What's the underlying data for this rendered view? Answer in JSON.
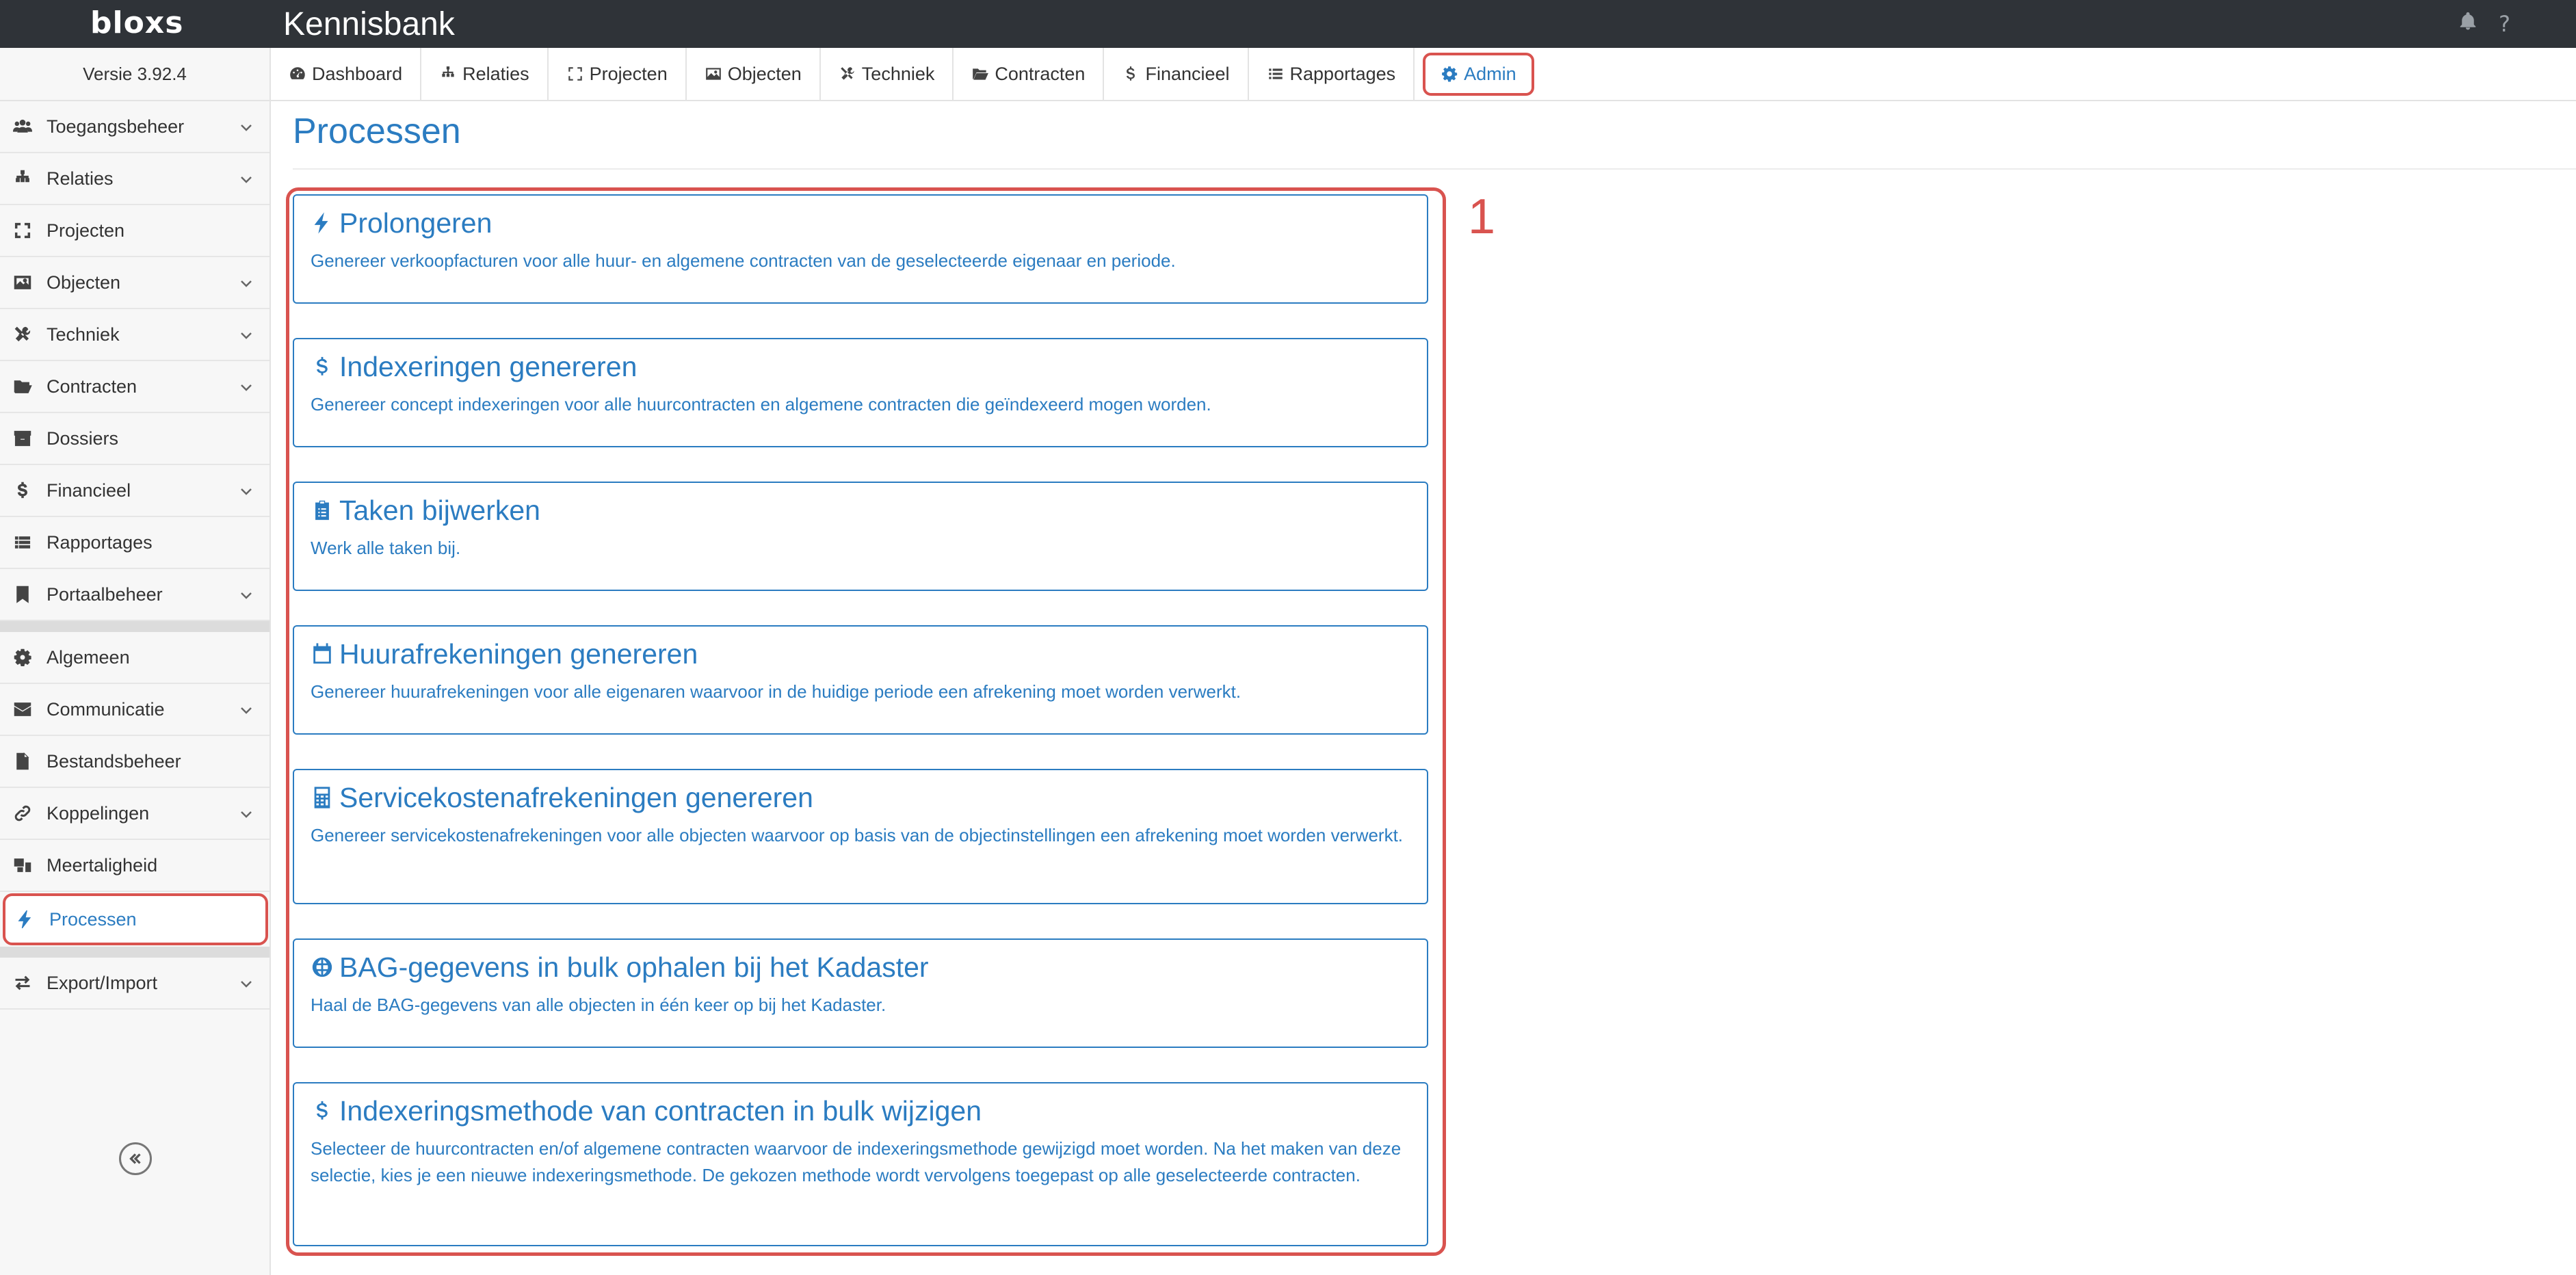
{
  "app": {
    "logo": "bloxs",
    "title": "Kennisbank",
    "version": "Versie 3.92.4"
  },
  "nav": {
    "tabs": [
      {
        "label": "Dashboard",
        "icon": "dashboard-icon"
      },
      {
        "label": "Relaties",
        "icon": "sitemap-icon"
      },
      {
        "label": "Projecten",
        "icon": "expand-icon"
      },
      {
        "label": "Objecten",
        "icon": "image-icon"
      },
      {
        "label": "Techniek",
        "icon": "tools-icon"
      },
      {
        "label": "Contracten",
        "icon": "folder-open-icon"
      },
      {
        "label": "Financieel",
        "icon": "dollar-icon"
      },
      {
        "label": "Rapportages",
        "icon": "list-icon"
      },
      {
        "label": "Admin",
        "icon": "gear-icon"
      }
    ]
  },
  "sidebar": {
    "items": [
      {
        "label": "Toegangsbeheer"
      },
      {
        "label": "Relaties"
      },
      {
        "label": "Projecten"
      },
      {
        "label": "Objecten"
      },
      {
        "label": "Techniek"
      },
      {
        "label": "Contracten"
      },
      {
        "label": "Dossiers"
      },
      {
        "label": "Financieel"
      },
      {
        "label": "Rapportages"
      },
      {
        "label": "Portaalbeheer"
      },
      {
        "label": "Algemeen"
      },
      {
        "label": "Communicatie"
      },
      {
        "label": "Bestandsbeheer"
      },
      {
        "label": "Koppelingen"
      },
      {
        "label": "Meertaligheid"
      },
      {
        "label": "Processen"
      },
      {
        "label": "Export/Import"
      }
    ]
  },
  "main": {
    "title": "Processen",
    "callout": "1",
    "processes": [
      {
        "title": "Prolongeren",
        "icon": "bolt-icon",
        "description": "Genereer verkoopfacturen voor alle huur- en algemene contracten van de geselecteerde eigenaar en periode."
      },
      {
        "title": "Indexeringen genereren",
        "icon": "dollar-icon",
        "description": "Genereer concept indexeringen voor alle huurcontracten en algemene contracten die geïndexeerd mogen worden."
      },
      {
        "title": "Taken bijwerken",
        "icon": "clipboard-icon",
        "description": "Werk alle taken bij."
      },
      {
        "title": "Huurafrekeningen genereren",
        "icon": "calendar-icon",
        "description": "Genereer huurafrekeningen voor alle eigenaren waarvoor in de huidige periode een afrekening moet worden verwerkt."
      },
      {
        "title": "Servicekostenafrekeningen genereren",
        "icon": "calculator-icon",
        "description": "Genereer servicekostenafrekeningen voor alle objecten waarvoor op basis van de objectinstellingen een afrekening moet worden verwerkt."
      },
      {
        "title": "BAG-gegevens in bulk ophalen bij het Kadaster",
        "icon": "globe-icon",
        "description": "Haal de BAG-gegevens van alle objecten in één keer op bij het Kadaster."
      },
      {
        "title": "Indexeringsmethode van contracten in bulk wijzigen",
        "icon": "dollar-icon",
        "description": "Selecteer de huurcontracten en/of algemene contracten waarvoor de indexeringsmethode gewijzigd moet worden. Na het maken van deze selectie, kies je een nieuwe indexeringsmethode. De gekozen methode wordt vervolgens toegepast op alle geselecteerde contracten."
      }
    ]
  },
  "colors": {
    "accent": "#2b7cc1",
    "highlight": "#d9534f",
    "topbar": "#2f3338"
  }
}
